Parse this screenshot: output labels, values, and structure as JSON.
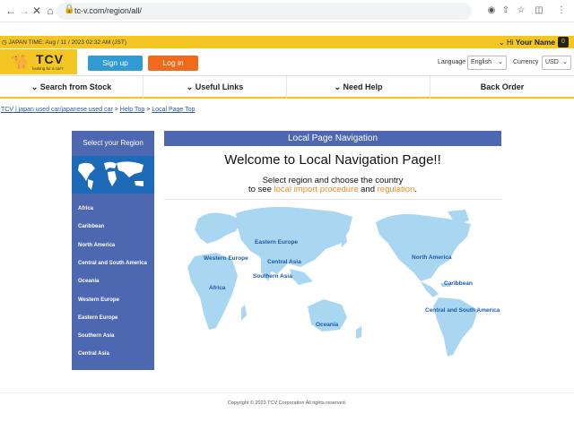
{
  "browser": {
    "url": "tc-v.com/region/all/"
  },
  "topbar": {
    "japan_time": "JAPAN TIME: Aug / 11 / 2023 02:32 AM (JST)",
    "hi": "Hi",
    "user_name": "Your Name",
    "cart_count": "0"
  },
  "header": {
    "logo_text": "TCV",
    "logo_tagline": "looking for a car?",
    "signup_label": "Sign up",
    "login_label": "Log in",
    "language_label": "Language",
    "language_value": "English",
    "currency_label": "Currency",
    "currency_value": "USD"
  },
  "menu": {
    "items": [
      {
        "label": "Search from Stock"
      },
      {
        "label": "Useful Links"
      },
      {
        "label": "Need Help"
      },
      {
        "label": "Back Order"
      }
    ]
  },
  "breadcrumb": {
    "items": [
      "TCV | japan used car/japanese used car",
      "Help Top",
      "Local Page Top"
    ],
    "sep": ">"
  },
  "sidebar": {
    "title": "Select your Region",
    "regions": [
      "Africa",
      "Caribbean",
      "North America",
      "Central and South America",
      "Oceania",
      "Western Europe",
      "Eastern Europe",
      "Southern Asia",
      "Central Asia"
    ]
  },
  "main": {
    "heading": "Local Page Navigation",
    "welcome": "Welcome to Local Navigation Page!!",
    "sub_line1": "Select region and choose the country",
    "sub_line2_pre": "to see",
    "link_import": "local import procedure",
    "sub_and": "and",
    "link_regulation": "regulation",
    "sub_end": "."
  },
  "map_labels": {
    "eastern_europe": "Eastern Europe",
    "western_europe": "Western Europe",
    "central_asia": "Central Asia",
    "southern_asia": "Southern Asia",
    "africa": "Africa",
    "oceania": "Oceania",
    "north_america": "North America",
    "caribbean": "Caribbean",
    "central_south_america": "Central and South America"
  },
  "footer": {
    "copyright": "Copyright © 2023 TCV Corporation All rights reserved."
  },
  "colors": {
    "brand_yellow": "#f3c623",
    "nav_blue": "#4d67b0",
    "signup_blue": "#2f9bd2",
    "login_orange": "#f06a1c",
    "map_blue": "#a9d7f2",
    "link_orange": "#f08a2a"
  }
}
